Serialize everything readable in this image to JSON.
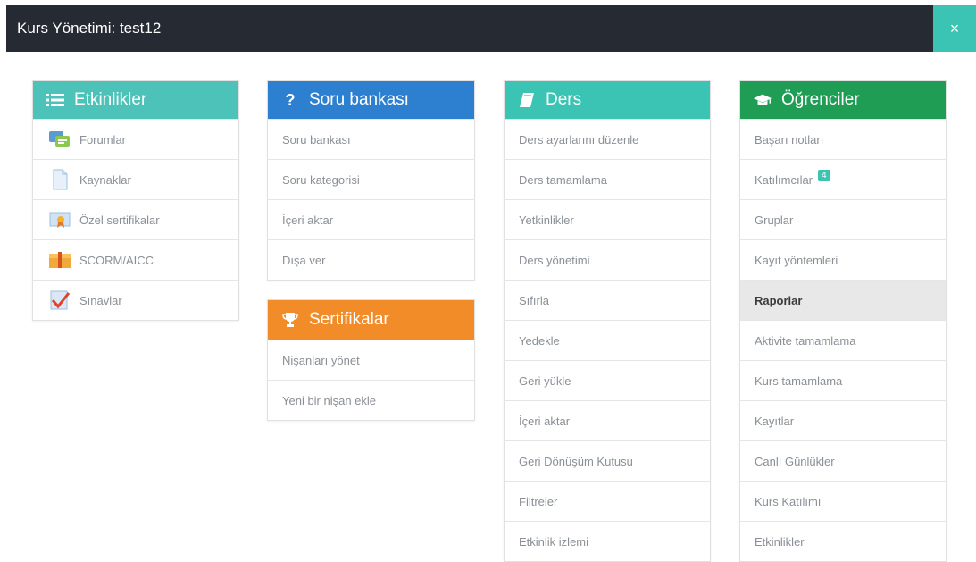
{
  "header": {
    "title": "Kurs Yönetimi: test12",
    "close_icon": "×"
  },
  "colors": {
    "teal": "#3bc4b4",
    "blue": "#2d7fd0",
    "lightteal": "#4cc2b8",
    "green": "#1f9d55",
    "orange": "#f28c28"
  },
  "etkinlikler": {
    "title": "Etkinlikler",
    "items": [
      {
        "label": "Forumlar",
        "icon": "forum-icon"
      },
      {
        "label": "Kaynaklar",
        "icon": "document-icon"
      },
      {
        "label": "Özel sertifikalar",
        "icon": "certificate-icon"
      },
      {
        "label": "SCORM/AICC",
        "icon": "package-icon"
      },
      {
        "label": "Sınavlar",
        "icon": "quiz-check-icon"
      }
    ]
  },
  "soru": {
    "title": "Soru bankası",
    "items": [
      "Soru bankası",
      "Soru kategorisi",
      "İçeri aktar",
      "Dışa ver"
    ]
  },
  "sertifikalar": {
    "title": "Sertifikalar",
    "items": [
      "Nişanları yönet",
      "Yeni bir nişan ekle"
    ]
  },
  "ders": {
    "title": "Ders",
    "items": [
      "Ders ayarlarını düzenle",
      "Ders tamamlama",
      "Yetkinlikler",
      "Ders yönetimi",
      "Sıfırla",
      "Yedekle",
      "Geri yükle",
      "İçeri aktar",
      "Geri Dönüşüm Kutusu",
      "Filtreler",
      "Etkinlik izlemi"
    ]
  },
  "ogrenciler": {
    "title": "Öğrenciler",
    "items": [
      "Başarı notları",
      "Katılımcılar",
      "Gruplar",
      "Kayıt yöntemleri",
      "Raporlar",
      "Aktivite tamamlama",
      "Kurs tamamlama",
      "Kayıtlar",
      "Canlı Günlükler",
      "Kurs Katılımı",
      "Etkinlikler"
    ],
    "badge": "4"
  }
}
